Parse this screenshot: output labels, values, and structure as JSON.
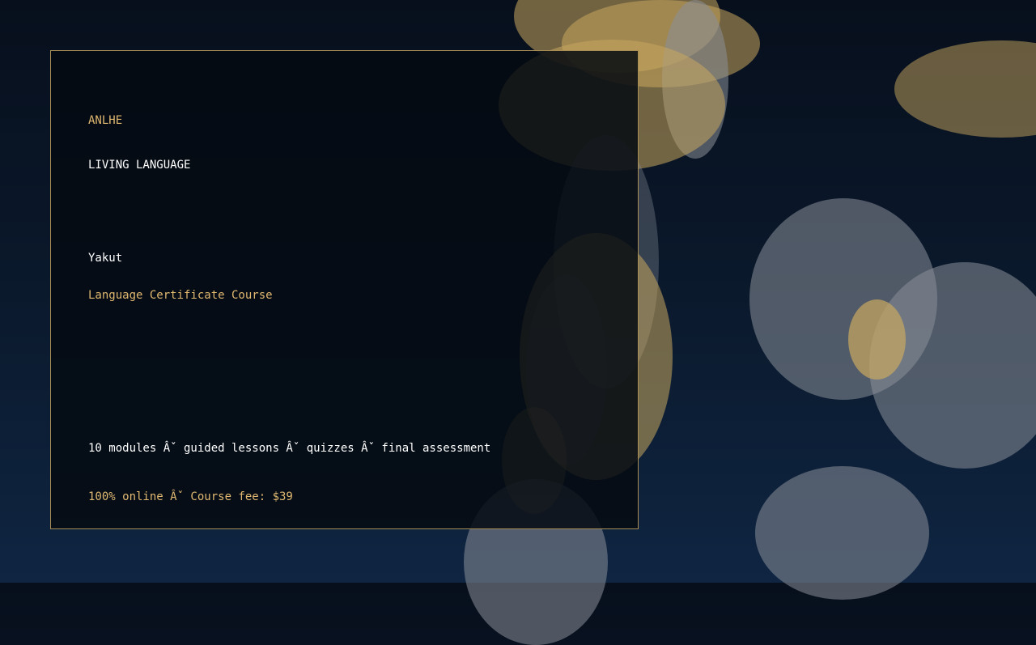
{
  "brand": {
    "name": "ANLHE",
    "tagline": "LIVING LANGUAGE"
  },
  "course": {
    "language": "Yakut",
    "title": "Language Certificate Course",
    "details": "10 modules Âˇ guided lessons Âˇ quizzes Âˇ final assessment",
    "pricing": "100% online Âˇ Course fee: $39"
  },
  "colors": {
    "accent": "#e0b870",
    "text": "#ffffff",
    "card_border": "#a88e55",
    "background_top": "#070f1c",
    "background_bottom": "#0f2542",
    "bokeh_gold": "#c9a85f",
    "bokeh_grey": "#8a9099"
  }
}
